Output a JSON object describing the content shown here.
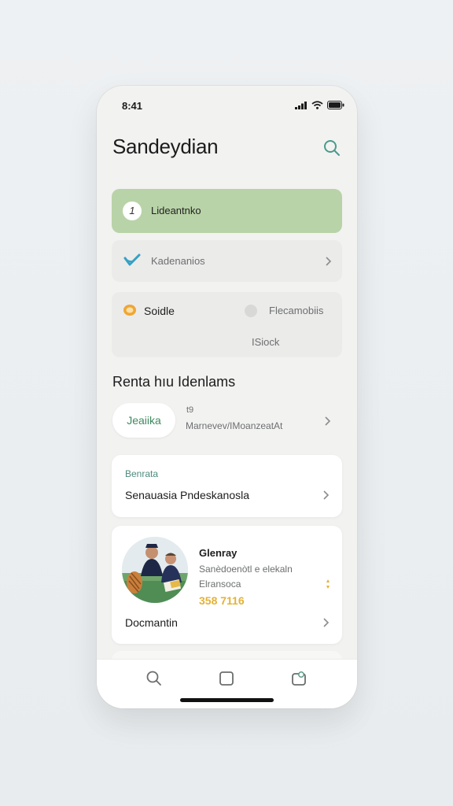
{
  "status": {
    "time": "8:41"
  },
  "header": {
    "title": "Sandeydian"
  },
  "list": {
    "item1": {
      "number": "1",
      "label": "Lideantnko"
    },
    "item2": {
      "label": "Kadenanios"
    },
    "item3": {
      "left_label": "Soidle",
      "right_label": "Flecamobiis",
      "sub_label": "ISiock"
    }
  },
  "section": {
    "title": "Renta hıu Idenlams",
    "pill": "Jeaiika",
    "side_top": "t9",
    "side_text": "Marnevev/IMoanzeatAt"
  },
  "card_a": {
    "eyebrow": "Benrata",
    "title": "Senauasia Pndeskanosla"
  },
  "card_b": {
    "name": "Glenray",
    "line1": "Sanèdoenòtl e elekaln",
    "line2": "Elransoca",
    "value": "358 7116",
    "footer": "Docmantin"
  },
  "colors": {
    "accent_green": "#b9d3a8",
    "value_yellow": "#e4b236",
    "pill_text": "#3d8a5e"
  },
  "icons": [
    "signal-icon",
    "wifi-icon",
    "battery-icon",
    "search-icon",
    "check-icon",
    "chevron-right-icon",
    "coin-icon",
    "circle-icon",
    "home-search-icon",
    "square-icon",
    "calendar-icon"
  ]
}
